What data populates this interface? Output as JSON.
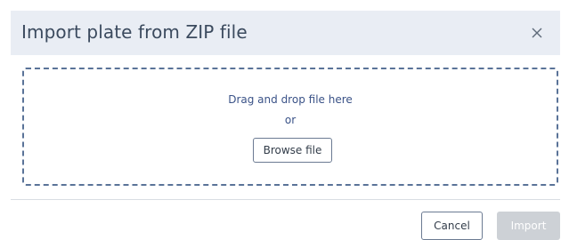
{
  "dialog": {
    "title": "Import plate from ZIP file",
    "close_icon": "close-icon"
  },
  "dropzone": {
    "instruction": "Drag and drop file here",
    "separator": "or",
    "browse_label": "Browse file"
  },
  "footer": {
    "cancel_label": "Cancel",
    "import_label": "Import",
    "import_disabled": true
  },
  "colors": {
    "header_bg": "#e9edf4",
    "title_text": "#3b4a5e",
    "dropzone_border": "#5a7398",
    "link_text": "#3a5287",
    "disabled_button": "#cdd1d6"
  }
}
